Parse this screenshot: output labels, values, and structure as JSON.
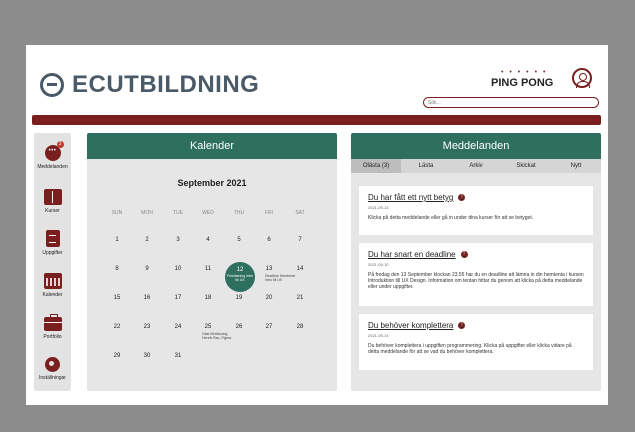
{
  "header": {
    "brand": "ECUTBILDNING",
    "partner_dots": "• • • • • •",
    "partner": "PING PONG",
    "search_placeholder": "Sök..."
  },
  "sidebar": {
    "items": [
      {
        "label": "Meddelanden",
        "icon": "chat-bubble-icon",
        "badge": "3"
      },
      {
        "label": "Kurser",
        "icon": "book-icon"
      },
      {
        "label": "Uppgifter",
        "icon": "document-icon"
      },
      {
        "label": "Kalender",
        "icon": "calendar-icon"
      },
      {
        "label": "Portfolio",
        "icon": "briefcase-icon"
      },
      {
        "label": "Inställningar",
        "icon": "gear-icon"
      }
    ]
  },
  "calendar": {
    "title": "Kalender",
    "month": "September 2021",
    "weekdays": [
      "SUN",
      "MON",
      "TUE",
      "WED",
      "THU",
      "FRI",
      "SAT"
    ],
    "weeks": [
      [
        "1",
        "2",
        "3",
        "4",
        "5",
        "6",
        "7"
      ],
      [
        "8",
        "9",
        "10",
        "11",
        "12",
        "13",
        "14"
      ],
      [
        "15",
        "16",
        "17",
        "18",
        "19",
        "20",
        "21"
      ],
      [
        "22",
        "23",
        "24",
        "25",
        "26",
        "27",
        "28"
      ],
      [
        "29",
        "30",
        "31",
        "",
        "",
        "",
        ""
      ]
    ],
    "today": "12",
    "today_event": "Föreläsning Intro till UX",
    "events": {
      "13": "Deadline Hemtenta Intro till UX",
      "25": "Gäst föreläsning Henrik Rau, Figma"
    }
  },
  "messages": {
    "title": "Meddelanden",
    "tabs": [
      "Olästa (3)",
      "Lästa",
      "Arkiv",
      "Skickat",
      "Nytt"
    ],
    "active_tab": "Olästa (3)",
    "items": [
      {
        "title": "Du har fått ett nytt betyg",
        "date": "2021-09-13",
        "text": "Klicka på detta meddelande eller gå in under dina kurser för att se betyget."
      },
      {
        "title": "Du har snart en deadline",
        "date": "2021-09-10",
        "text": "På fredag den 13 September klockan 23.55 har du en deadline att lämna in din hemtenta i kursen Introduktion till UX Design. Information om tentan hittar du genom att klicka på detta meddelande eller under uppgifter."
      },
      {
        "title": "Du behöver komplettera",
        "date": "2021-09-14",
        "text": "Du behöver komplettera i uppgiften programmering. Klicka på uppgifter eller klicka vidare på detta meddelande för att se vad du behöver komplettera."
      }
    ]
  },
  "colors": {
    "accent_green": "#2f6f5e",
    "accent_red": "#7a1f1f",
    "brand_gray": "#4a5a68"
  }
}
